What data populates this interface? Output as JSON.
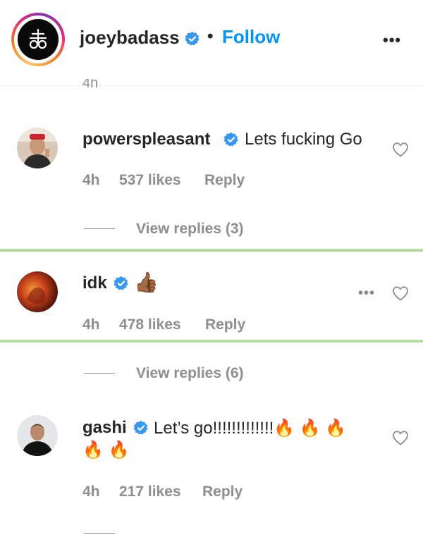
{
  "header": {
    "username": "joeybadass",
    "separator": "•",
    "follow_label": "Follow",
    "more_label": "•••",
    "avatar_icon": "sigil-icon",
    "verified_color": "#3897f0"
  },
  "cut_off_text": "4h",
  "comments": [
    {
      "username": "powerspleasant",
      "text": "Lets fucking Go",
      "time": "4h",
      "likes": "537 likes",
      "reply_label": "Reply",
      "view_replies": "View replies (3)"
    },
    {
      "username": "idk",
      "text": "👍🏾",
      "time": "4h",
      "likes": "478 likes",
      "reply_label": "Reply",
      "more_label": "•••",
      "view_replies": "View replies (6)"
    },
    {
      "username": "gashi",
      "text_line1": "Let’s go!!!!!!!!!!!!!🔥 🔥 🔥",
      "text_line2": "🔥 🔥",
      "time": "4h",
      "likes": "217 likes",
      "reply_label": "Reply"
    }
  ],
  "colors": {
    "link_blue": "#0095f6",
    "muted_gray": "#8e8e8e",
    "highlight_green": "#b6dca0"
  }
}
